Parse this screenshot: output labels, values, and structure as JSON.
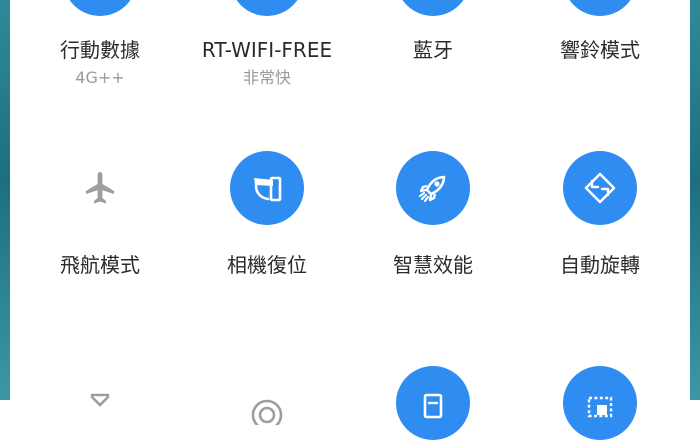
{
  "tiles_row1": [
    {
      "label": "行動數據",
      "sub": "4G++"
    },
    {
      "label": "RT-WIFI-FREE",
      "sub": "非常快"
    },
    {
      "label": "藍牙",
      "sub": ""
    },
    {
      "label": "響鈴模式",
      "sub": ""
    }
  ],
  "tiles_row2": [
    {
      "label": "飛航模式",
      "icon": "airplane-icon",
      "active": false
    },
    {
      "label": "相機復位",
      "icon": "camera-reset-icon",
      "active": true
    },
    {
      "label": "智慧效能",
      "icon": "rocket-icon",
      "active": true
    },
    {
      "label": "自動旋轉",
      "icon": "auto-rotate-icon",
      "active": true
    }
  ],
  "tiles_row3": [
    {
      "icon": "hourglass-icon",
      "active": false
    },
    {
      "icon": "hotspot-icon",
      "active": false
    },
    {
      "icon": "document-icon",
      "active": true
    },
    {
      "icon": "screenshot-icon",
      "active": true
    }
  ],
  "colors": {
    "accent": "#2f8cf1",
    "inactive_icon": "#9e9e9e",
    "edge": "#1d6f80"
  }
}
